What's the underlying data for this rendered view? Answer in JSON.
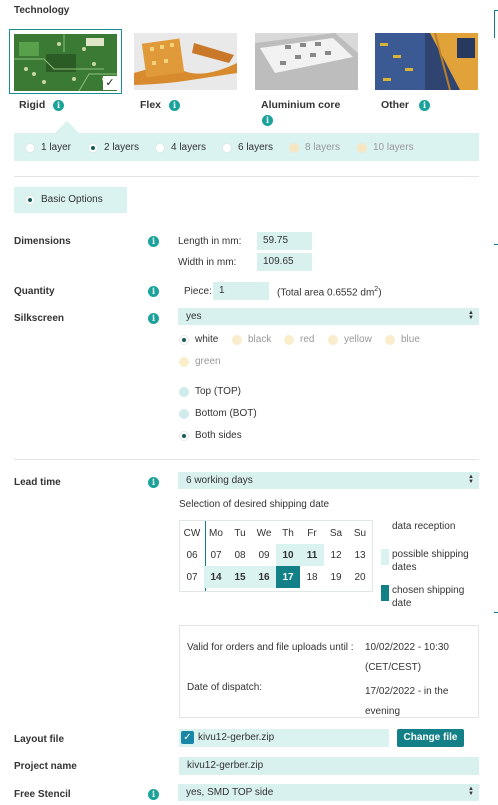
{
  "technology": {
    "heading": "Technology",
    "options": [
      {
        "label": "Rigid",
        "selected": true
      },
      {
        "label": "Flex",
        "selected": false
      },
      {
        "label": "Aluminium core",
        "selected": false
      },
      {
        "label": "Other",
        "selected": false
      }
    ],
    "check": "✓"
  },
  "layers": [
    {
      "label": "1 layer",
      "state": "enabled"
    },
    {
      "label": "2 layers",
      "state": "selected"
    },
    {
      "label": "4 layers",
      "state": "enabled"
    },
    {
      "label": "6 layers",
      "state": "enabled"
    },
    {
      "label": "8 layers",
      "state": "disabled"
    },
    {
      "label": "10 layers",
      "state": "disabled"
    }
  ],
  "basic_options": "Basic Options",
  "dimensions": {
    "label": "Dimensions",
    "length_label": "Length in mm:",
    "length_value": "59.75",
    "width_label": "Width in mm:",
    "width_value": "109.65"
  },
  "quantity": {
    "label": "Quantity",
    "piece_label": "Piece:",
    "piece_value": "1",
    "area_prefix": "(Total area 0.6552 dm",
    "area_sup": "2",
    "area_suffix": ")"
  },
  "silkscreen": {
    "label": "Silkscreen",
    "select_value": "yes",
    "colors": [
      "white",
      "black",
      "red",
      "yellow",
      "blue",
      "green"
    ],
    "selected_color": "white",
    "sides": [
      "Top (TOP)",
      "Bottom (BOT)",
      "Both sides"
    ],
    "selected_side": "Both sides"
  },
  "lead_time": {
    "label": "Lead time",
    "select_value": "6 working days",
    "calendar_caption": "Selection of desired shipping date",
    "header": [
      "CW",
      "Mo",
      "Tu",
      "We",
      "Th",
      "Fr",
      "Sa",
      "Su"
    ],
    "weeks": [
      {
        "cw": "06",
        "days": [
          "07",
          "08",
          "09",
          "10",
          "11",
          "12",
          "13"
        ],
        "states": [
          "n",
          "n",
          "n",
          "p",
          "p",
          "n",
          "n"
        ]
      },
      {
        "cw": "07",
        "days": [
          "14",
          "15",
          "16",
          "17",
          "18",
          "19",
          "20"
        ],
        "states": [
          "p",
          "p",
          "p",
          "c",
          "n",
          "n",
          "n"
        ]
      }
    ],
    "legend": {
      "reception": "data reception",
      "possible": "possible shipping dates",
      "chosen": "chosen shipping date"
    },
    "valid_label": "Valid for orders and file uploads until :",
    "valid_value": "10/02/2022 - 10:30 (CET/CEST)",
    "dispatch_label": "Date of dispatch:",
    "dispatch_value": "17/02/2022 - in the evening"
  },
  "layout_file": {
    "label": "Layout file",
    "file_name": "kivu12-gerber.zip",
    "change_button": "Change file"
  },
  "project_name": {
    "label": "Project name",
    "value": "kivu12-gerber.zip"
  },
  "free_stencil": {
    "label": "Free Stencil",
    "select_value": "yes, SMD TOP side"
  },
  "colors": {
    "accent": "#1aa39a",
    "teal_dark": "#137f86",
    "panel": "#daf2f0",
    "field": "#d8f0ee"
  }
}
